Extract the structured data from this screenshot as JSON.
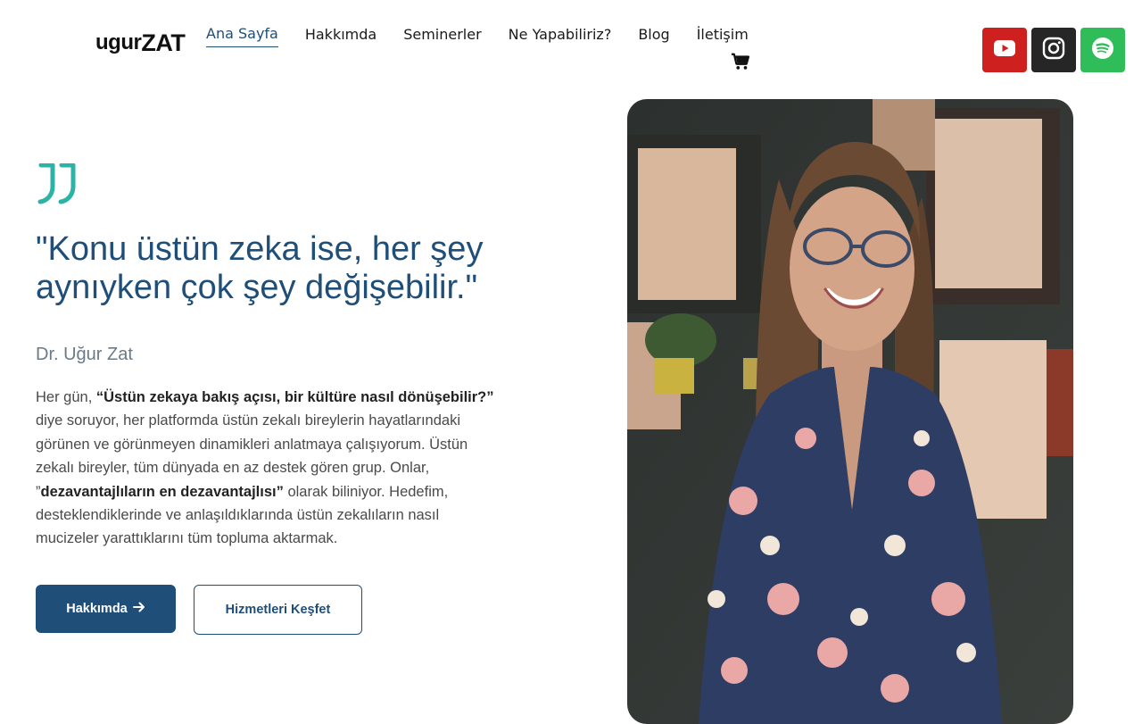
{
  "logo": {
    "part1": "ugur",
    "part2": "ZAT"
  },
  "nav": {
    "items": [
      {
        "label": "Ana Sayfa"
      },
      {
        "label": "Hakkımda"
      },
      {
        "label": "Seminerler"
      },
      {
        "label": "Ne Yapabiliriz?"
      },
      {
        "label": "Blog"
      },
      {
        "label": "İletişim"
      }
    ],
    "active": "Ana Sayfa"
  },
  "icons": {
    "cart": "cart-icon",
    "youtube": "youtube-icon",
    "instagram": "instagram-icon",
    "spotify": "spotify-icon",
    "quote": "quote-icon",
    "arrow": "arrow-right-icon"
  },
  "colors": {
    "primary": "#1f4e79",
    "youtube": "#cd201f",
    "instagram": "#262626",
    "spotify": "#2ebd59",
    "quote_accent": "#2bb3a6"
  },
  "hero": {
    "quote": "\"Konu üstün zeka ise, her şey aynıyken çok şey değişebilir.\"",
    "author": "Dr. Uğur Zat",
    "bio": {
      "p1": "Her gün, ",
      "b1": "“Üstün zekaya bakış açısı, bir kültüre nasıl dönüşebilir?”",
      "p2": " diye soruyor, her platformda üstün zekalı bireylerin hayatlarındaki görünen ve görünmeyen dinamikleri anlatmaya çalışıyorum. Üstün zekalı bireyler, tüm dünyada en az destek gören grup. Onlar, ”",
      "b2": "dezavantajlıların en dezavantajlısı”",
      "p3": " olarak biliniyor. Hedefim, desteklendiklerinde ve anlaşıldıklarında üstün zekalıların nasıl mucizeler yarattıklarını tüm topluma aktarmak."
    },
    "primary_button": "Hakkımda",
    "secondary_button": "Hizmetleri Keşfet"
  }
}
